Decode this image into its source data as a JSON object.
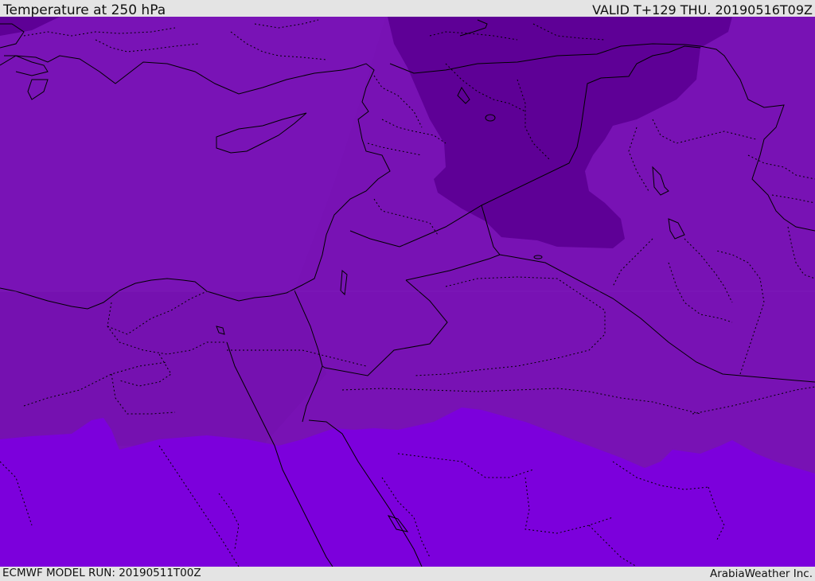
{
  "header": {
    "title": "Temperature at 250 hPa",
    "valid": "VALID T+129 THU. 20190516T09Z"
  },
  "footer": {
    "model_run": "ECMWF MODEL RUN: 20190511T00Z",
    "brand": "ArabiaWeather Inc."
  },
  "map": {
    "colors": {
      "cold_band": "#5e0096",
      "mid_band": "#7812b4",
      "warm_band": "#7c00dc",
      "boundary": "#000000"
    }
  }
}
